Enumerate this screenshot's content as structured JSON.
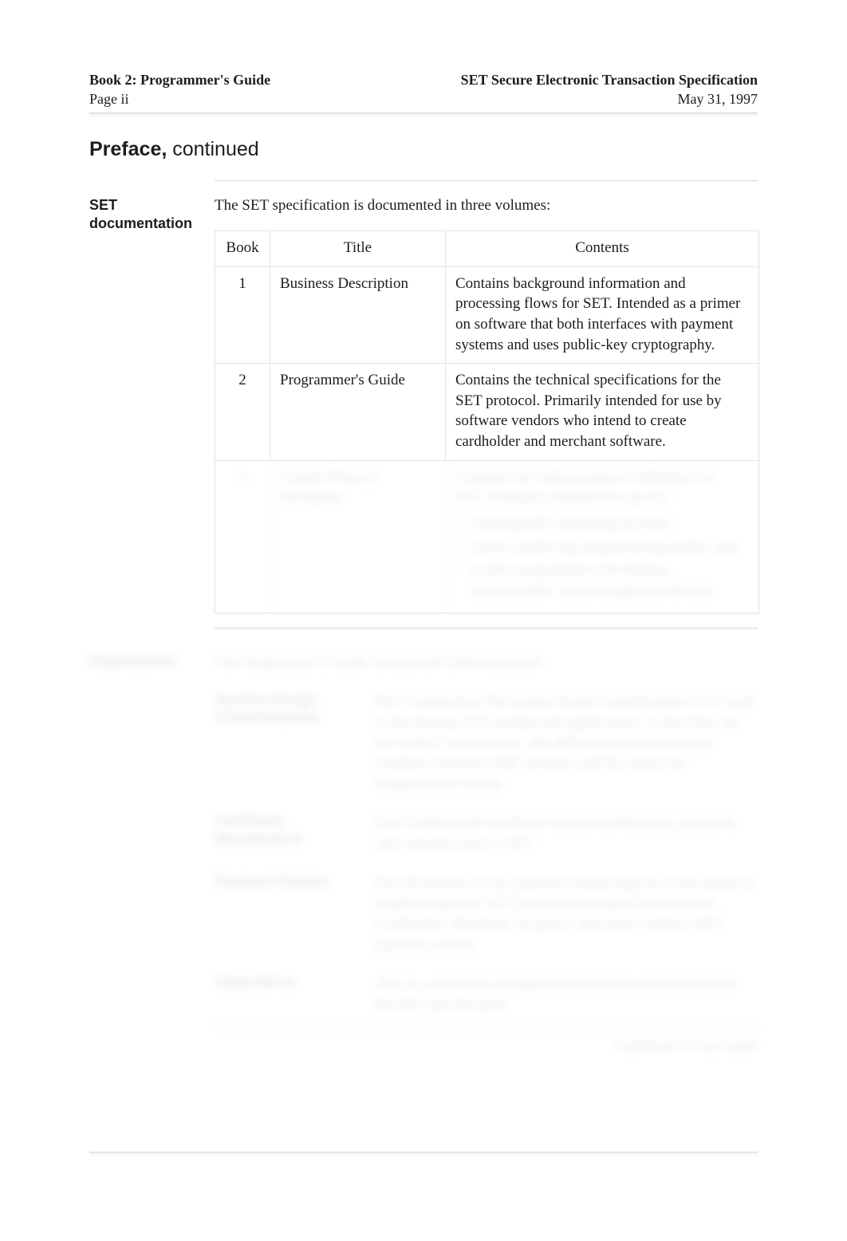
{
  "header": {
    "left_title": "Book 2: Programmer's Guide",
    "left_sub": "Page ii",
    "right_title": "SET Secure Electronic Transaction Specification",
    "right_sub": "May 31, 1997"
  },
  "preface": {
    "heading": "Preface,",
    "continued": " continued"
  },
  "documentation": {
    "label": "SET documentation",
    "intro": "The SET specification is documented in three volumes:",
    "cols": {
      "book": "Book",
      "title": "Title",
      "contents": "Contents"
    },
    "rows": [
      {
        "book": "1",
        "title": "Business Description",
        "contents": "Contains background information and processing flows for SET. Intended as a primer on software that both interfaces with payment systems and uses public-key cryptography."
      },
      {
        "book": "2",
        "title": "Programmer's Guide",
        "contents": "Contains the technical specifications for the SET protocol. Primarily intended for use by software vendors who intend to create cardholder and merchant software."
      },
      {
        "book": "3",
        "title": "Formal Protocol Definition",
        "contents_lead": "Contains the formal protocol definition for SET. Primarily intended for use by:",
        "bullets": [
          "cryptographic analyzing security;",
          "writers producing programming guides; and",
          "system programmers developing cryptographic and messaging primitives."
        ]
      }
    ]
  },
  "organization": {
    "label": "Organization",
    "intro": "The Programmer's Guide contains the following parts:",
    "parts": [
      {
        "name": "System Design Considerations",
        "desc": "Part I summarizes the system design considerations to be used in developing SET toolkits and applications. It also lists, for the reader's convenience, the differences in content and emphasis between draft versions and this approved Programmer's Guide."
      },
      {
        "name": "Certificate Management",
        "desc": "Part II defines the certificate request architecture, protocols, and concepts used in SET."
      },
      {
        "name": "Payment System",
        "desc": "Part III focuses on the payment-related aspects of the protocol, emphasizing how SET payment messages flow between Cardholder, Merchant, Acquirer, and Issuer within a SET payment system."
      },
      {
        "name": "Appendices",
        "desc": "This is a collection of supplementary information related to the SET specification."
      }
    ],
    "continued": "Continued on next page"
  }
}
